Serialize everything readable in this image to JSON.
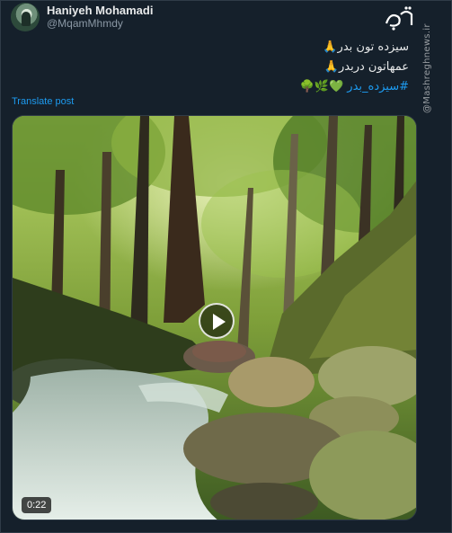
{
  "post": {
    "display_name": "Haniyeh Mohamadi",
    "handle": "@MqamMhmdy",
    "text_line_1": "سیزده تون بدر🙏",
    "text_line_2": "عمهاتون دربدر🙏",
    "hashtag": "#سیزده_بدر",
    "hashtag_emojis": "💚🌿🌳",
    "translate_label": "Translate post"
  },
  "media": {
    "type": "video",
    "duration": "0:22",
    "icon": "play-icon"
  },
  "brand": {
    "watermark": "@Mashreghnews.ir"
  },
  "colors": {
    "background": "#15202b",
    "link": "#1d9bf0",
    "secondary_text": "#8b98a5"
  }
}
